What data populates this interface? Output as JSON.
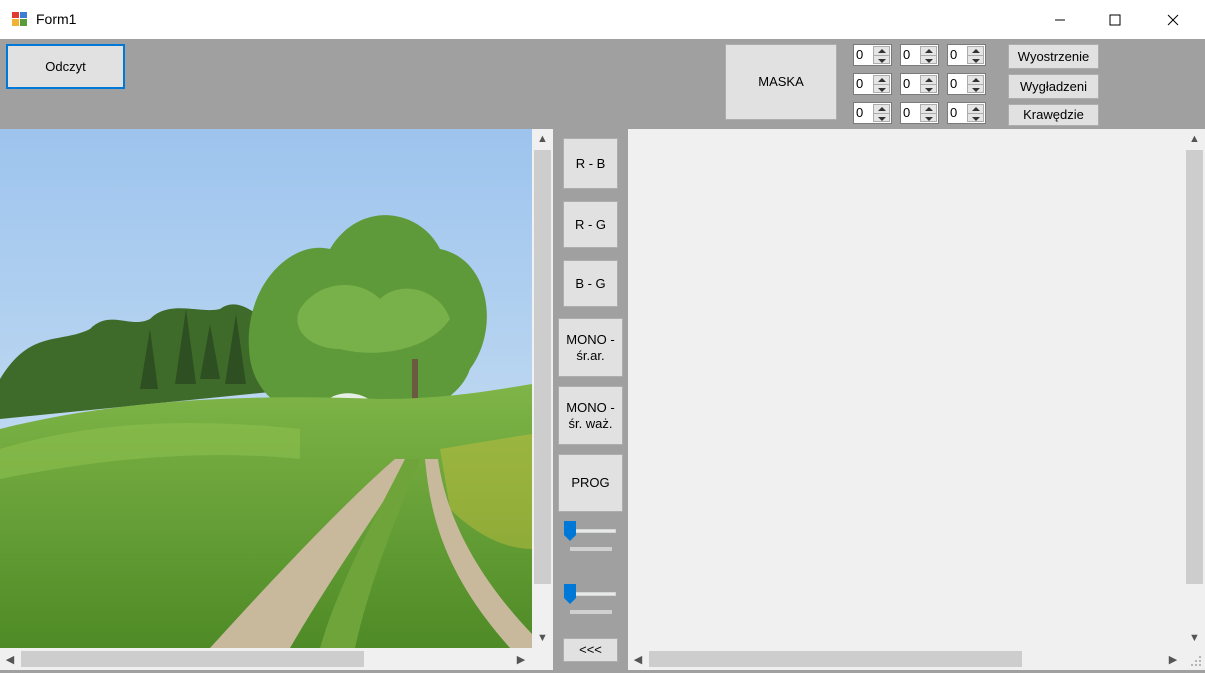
{
  "window": {
    "title": "Form1",
    "controls": {
      "minimize": "—",
      "maximize": "☐",
      "close": "✕"
    }
  },
  "toolbar": {
    "read_button": "Odczyt",
    "mask_button": "MASKA",
    "mask_values": [
      [
        "0",
        "0",
        "0"
      ],
      [
        "0",
        "0",
        "0"
      ],
      [
        "0",
        "0",
        "0"
      ]
    ],
    "sharpen_button": "Wyostrzenie",
    "smooth_button": "Wygładzeni",
    "edges_button": "Krawędzie"
  },
  "middle": {
    "rb_button": "R - B",
    "rg_button": "R - G",
    "bg_button": "B - G",
    "mono_avg_line1": "MONO -",
    "mono_avg_line2": "śr.ar.",
    "mono_weighted_line1": "MONO -",
    "mono_weighted_line2": "śr. waż.",
    "threshold_button": "PROG",
    "slider1_value": 0,
    "slider2_value": 0,
    "back_button": "<<<"
  },
  "colors": {
    "accent": "#0078d7",
    "toolbar_bg": "#a0a0a0",
    "panel_bg": "#f0f0f0"
  },
  "icons": {
    "scroll_up": "▲",
    "scroll_down": "▼",
    "scroll_left": "◀",
    "scroll_right": "▶"
  }
}
